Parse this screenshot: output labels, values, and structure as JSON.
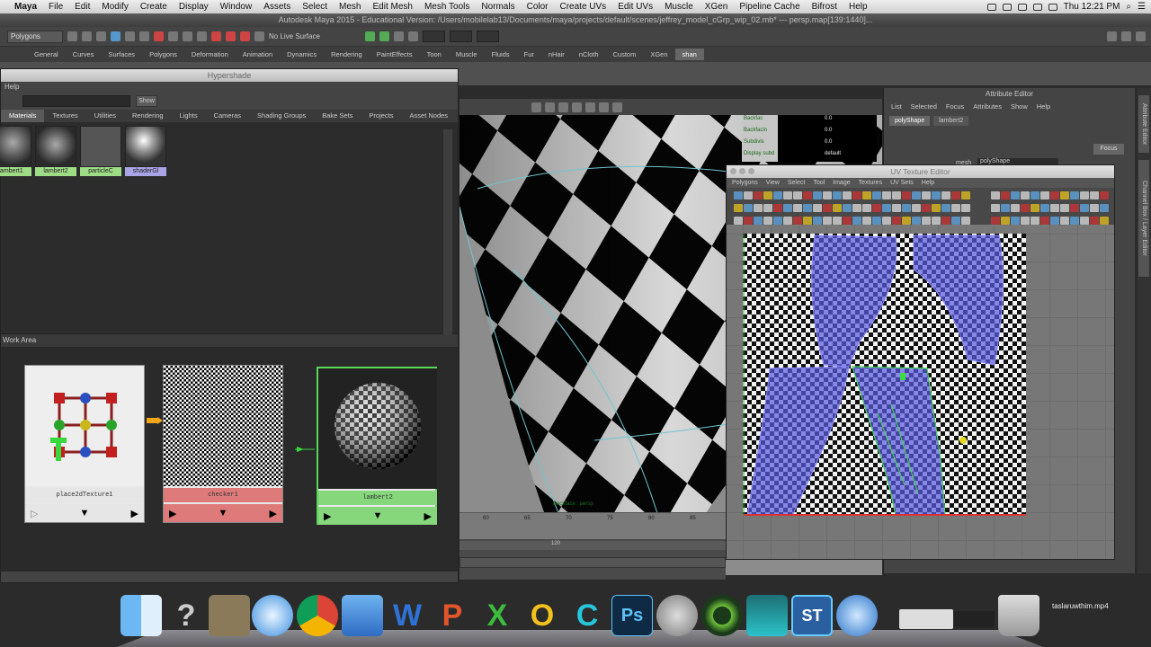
{
  "menubar": {
    "apple": "",
    "items": [
      "Maya",
      "File",
      "Edit",
      "Modify",
      "Create",
      "Display",
      "Window",
      "Assets",
      "Select",
      "Mesh",
      "Edit Mesh",
      "Mesh Tools",
      "Normals",
      "Color",
      "Create UVs",
      "Edit UVs",
      "Muscle",
      "XGen",
      "Pipeline Cache",
      "Bifrost",
      "Help"
    ],
    "clock": "Thu 12:21 PM"
  },
  "maya_window": {
    "title": "Autodesk Maya 2015 - Educational Version: /Users/mobilelab13/Documents/maya/projects/default/scenes/jeffrey_model_cGrp_wip_02.mb* --- persp.map[139:1440]..."
  },
  "statusline": {
    "mode": "Polygons",
    "live_surface": "No Live Surface"
  },
  "shelf": {
    "tabs": [
      "General",
      "Curves",
      "Surfaces",
      "Polygons",
      "Deformation",
      "Animation",
      "Dynamics",
      "Rendering",
      "PaintEffects",
      "Toon",
      "Muscle",
      "Fluids",
      "Fur",
      "nHair",
      "nCloth",
      "Custom",
      "XGen",
      "shan"
    ],
    "active": "shan"
  },
  "hypershade": {
    "title": "Hypershade",
    "menu": "Help",
    "search_button": "Show",
    "tabs": [
      "Materials",
      "Textures",
      "Utilities",
      "Rendering",
      "Lights",
      "Cameras",
      "Shading Groups",
      "Bake Sets",
      "Projects",
      "Asset Nodes"
    ],
    "active_tab": "Materials",
    "swatches": [
      {
        "label": "lambert1",
        "color": "#9fdc86"
      },
      {
        "label": "lambert2",
        "color": "#9fdc86"
      },
      {
        "label": "particleC",
        "color": "#9fdc86"
      },
      {
        "label": "shaderGl",
        "color": "#a9a4e6"
      }
    ],
    "work_area_label": "Work Area",
    "nodes": [
      {
        "label": "place2dTexture1",
        "color": "#e6e6e6"
      },
      {
        "label": "checker1",
        "color": "#de7a7a"
      },
      {
        "label": "lambert2",
        "color": "#86d67c"
      }
    ]
  },
  "viewport": {
    "label": "Backface : persp",
    "channels": [
      "Backfac",
      "Backfacin",
      "Subdivis",
      "Display subd"
    ],
    "values": [
      "0.0",
      "0.0",
      "0.0",
      "default"
    ]
  },
  "attribute_editor": {
    "title": "Attribute Editor",
    "menu": [
      "List",
      "Selected",
      "Focus",
      "Attributes",
      "Show",
      "Help"
    ],
    "tabs": [
      "polyShape",
      "lambert2"
    ],
    "focus_button": "Focus",
    "mesh_label": "mesh",
    "mesh_value": "polyShape"
  },
  "side_tabs": [
    "Attribute Editor",
    "Channel Box / Layer Editor"
  ],
  "uv_editor": {
    "title": "UV Texture Editor",
    "menu": [
      "Polygons",
      "View",
      "Select",
      "Tool",
      "Image",
      "Textures",
      "UV Sets",
      "Help"
    ]
  },
  "timeline": {
    "ticks": [
      "60",
      "65",
      "70",
      "75",
      "80",
      "85"
    ],
    "frame": "120"
  },
  "dock": {
    "apps": [
      "Finder",
      "Help",
      "Preview",
      "Safari",
      "Chrome",
      "Xcode",
      "Word",
      "PowerPoint",
      "Excel",
      "Outlook",
      "C",
      "Photoshop",
      "System Preferences",
      "Maya",
      "Maya 2015",
      "ST",
      "QuickTime",
      "Screen",
      "Printer",
      "Trash"
    ]
  },
  "desktop_file": "taslaruwthim.mp4",
  "colors": {
    "uv_shell_fill": "#5a5ae0",
    "uv_edge_selection": "#39e13e",
    "uv_border": "#d33"
  }
}
